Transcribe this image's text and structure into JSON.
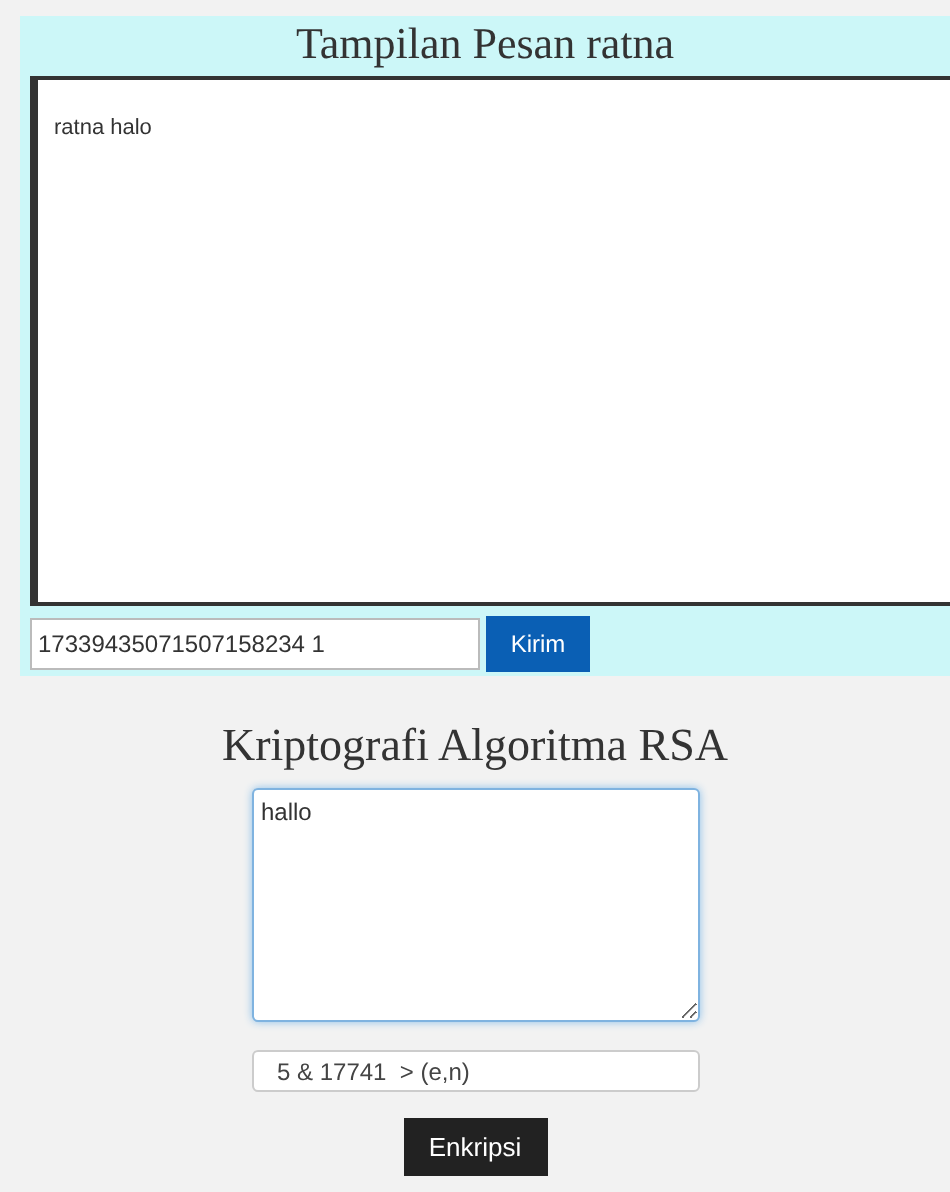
{
  "chat": {
    "title": "Tampilan Pesan ratna",
    "messages": [
      "ratna halo"
    ],
    "input_value": "17339435071507158234 1",
    "send_button": "Kirim"
  },
  "crypto": {
    "title": "Kriptografi Algoritma RSA",
    "plaintext": "hallo",
    "key_value": "5 & 17741  > (e,n)",
    "encrypt_button": "Enkripsi"
  }
}
